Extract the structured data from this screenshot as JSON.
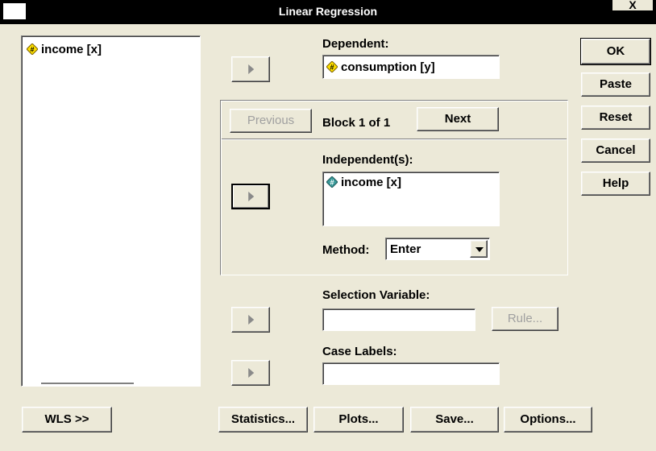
{
  "window": {
    "title": "Linear Regression",
    "close_label": "X"
  },
  "source_list": {
    "items": [
      {
        "label": "income [x]",
        "icon": "scale-variable-icon"
      }
    ]
  },
  "dependent": {
    "label": "Dependent:",
    "value": "consumption [y]",
    "icon": "scale-variable-icon"
  },
  "block": {
    "previous_label": "Previous",
    "status": "Block 1 of 1",
    "next_label": "Next"
  },
  "independents": {
    "label": "Independent(s):",
    "items": [
      {
        "label": "income [x]",
        "icon": "scale-variable-icon-selected"
      }
    ]
  },
  "method": {
    "label": "Method:",
    "value": "Enter"
  },
  "selection_variable": {
    "label": "Selection Variable:",
    "value": "",
    "rule_label": "Rule..."
  },
  "case_labels": {
    "label": "Case Labels:",
    "value": ""
  },
  "side_buttons": {
    "ok": "OK",
    "paste": "Paste",
    "reset": "Reset",
    "cancel": "Cancel",
    "help": "Help"
  },
  "bottom_buttons": {
    "wls": "WLS >>",
    "statistics": "Statistics...",
    "plots": "Plots...",
    "save": "Save...",
    "options": "Options..."
  },
  "colors": {
    "dialog_bg": "#ece9d8",
    "titlebar": "#000000",
    "icon_yellow": "#ffe000",
    "icon_teal": "#3a9a9a"
  }
}
